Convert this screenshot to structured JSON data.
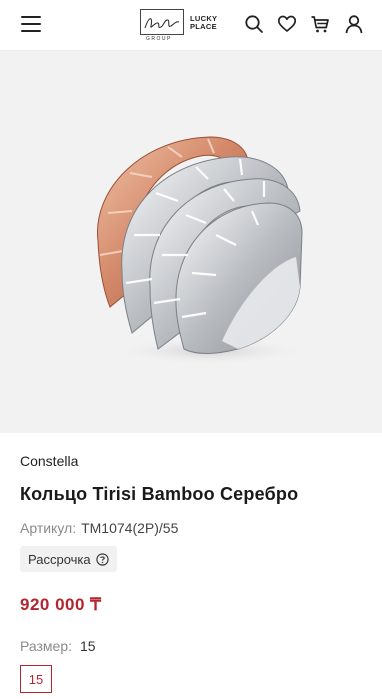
{
  "header": {
    "logo_signature": "Zhanna Kim",
    "logo_group": "GROUP",
    "logo_brand_line1": "LUCKY",
    "logo_brand_line2": "PLACE",
    "icons": [
      "menu-icon",
      "search-icon",
      "heart-icon",
      "cart-icon",
      "user-icon"
    ]
  },
  "product": {
    "brand": "Constella",
    "title": "Кольцо Tirisi Bamboo Серебро",
    "sku_label": "Артикул:",
    "sku_value": "TM1074(2P)/55",
    "installment_label": "Рассрочка",
    "price": "920 000 ₸",
    "size_label": "Размер:",
    "size_value": "15",
    "size_options": [
      "15"
    ]
  },
  "colors": {
    "accent": "#b3262f",
    "image_bg": "#f2f2f2",
    "rose_gold": "#d99173",
    "silver": "#c9ccd0"
  }
}
